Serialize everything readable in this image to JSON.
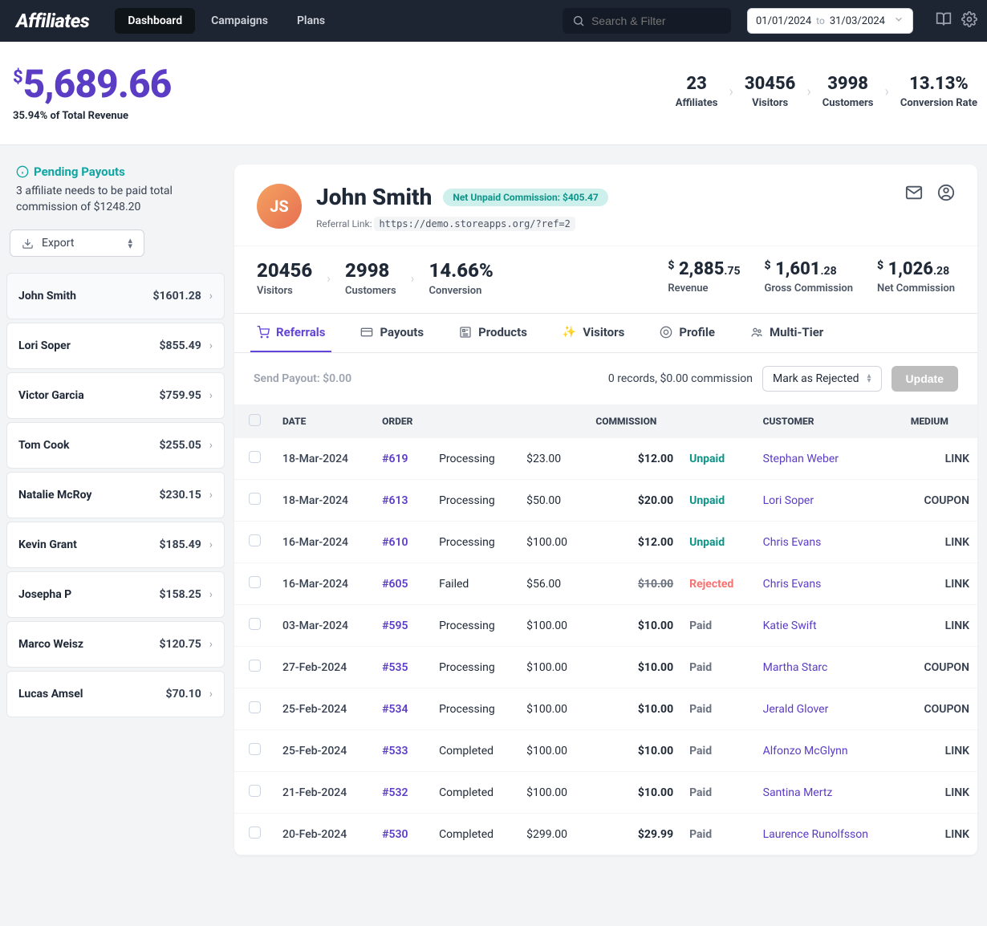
{
  "nav": {
    "brand": "Affiliates",
    "items": [
      "Dashboard",
      "Campaigns",
      "Plans"
    ],
    "active": 0,
    "search_placeholder": "Search & Filter",
    "date_from": "01/01/2024",
    "date_to_label": "to",
    "date_to": "31/03/2024"
  },
  "kpi": {
    "revenue": "5,689.66",
    "revenue_sub": "35.94% of Total Revenue",
    "stats": [
      {
        "v": "23",
        "l": "Affiliates"
      },
      {
        "v": "30456",
        "l": "Visitors"
      },
      {
        "v": "3998",
        "l": "Customers"
      },
      {
        "v": "13.13%",
        "l": "Conversion Rate"
      }
    ]
  },
  "sidebar": {
    "title": "Pending Payouts",
    "desc": "3 affiliate needs to be paid total commission of $1248.20",
    "export": "Export",
    "affiliates": [
      {
        "name": "John Smith",
        "amt": "$1601.28",
        "sel": true
      },
      {
        "name": "Lori Soper",
        "amt": "$855.49"
      },
      {
        "name": "Victor Garcia",
        "amt": "$759.95"
      },
      {
        "name": "Tom Cook",
        "amt": "$255.05"
      },
      {
        "name": "Natalie McRoy",
        "amt": "$230.15"
      },
      {
        "name": "Kevin Grant",
        "amt": "$185.49"
      },
      {
        "name": "Josepha P",
        "amt": "$158.25"
      },
      {
        "name": "Marco Weisz",
        "amt": "$120.75"
      },
      {
        "name": "Lucas Amsel",
        "amt": "$70.10"
      }
    ]
  },
  "detail": {
    "name": "John Smith",
    "avatar_initials": "JS",
    "badge": "Net Unpaid Commission: $405.47",
    "ref_label": "Referral Link:",
    "ref_url": "https://demo.storeapps.org/?ref=2",
    "stats": [
      {
        "v": "20456",
        "l": "Visitors"
      },
      {
        "v": "2998",
        "l": "Customers"
      },
      {
        "v": "14.66%",
        "l": "Conversion"
      }
    ],
    "money": [
      {
        "whole": "2,885",
        "cents": ".75",
        "l": "Revenue"
      },
      {
        "whole": "1,601",
        "cents": ".28",
        "l": "Gross Commission"
      },
      {
        "whole": "1,026",
        "cents": ".28",
        "l": "Net Commission"
      }
    ],
    "tabs": [
      "Referrals",
      "Payouts",
      "Products",
      "Visitors",
      "Profile",
      "Multi-Tier"
    ],
    "active_tab": 0,
    "send_payout": "Send Payout: $0.00",
    "records_info": "0 records, $0.00 commission",
    "mark_label": "Mark as Rejected",
    "update_label": "Update",
    "columns": [
      "DATE",
      "ORDER",
      "",
      "",
      "COMMISSION",
      "",
      "CUSTOMER",
      "MEDIUM"
    ],
    "rows": [
      {
        "date": "18-Mar-2024",
        "order": "#619",
        "ostatus": "Processing",
        "amount": "$23.00",
        "comm": "$12.00",
        "cstatus": "Unpaid",
        "cust": "Stephan Weber",
        "medium": "LINK"
      },
      {
        "date": "18-Mar-2024",
        "order": "#613",
        "ostatus": "Processing",
        "amount": "$50.00",
        "comm": "$20.00",
        "cstatus": "Unpaid",
        "cust": "Lori Soper",
        "medium": "COUPON"
      },
      {
        "date": "16-Mar-2024",
        "order": "#610",
        "ostatus": "Processing",
        "amount": "$100.00",
        "comm": "$12.00",
        "cstatus": "Unpaid",
        "cust": "Chris Evans",
        "medium": "LINK"
      },
      {
        "date": "16-Mar-2024",
        "order": "#605",
        "ostatus": "Failed",
        "amount": "$56.00",
        "comm": "$10.00",
        "cstatus": "Rejected",
        "cust": "Chris Evans",
        "medium": "LINK"
      },
      {
        "date": "03-Mar-2024",
        "order": "#595",
        "ostatus": "Processing",
        "amount": "$100.00",
        "comm": "$10.00",
        "cstatus": "Paid",
        "cust": "Katie Swift",
        "medium": "LINK"
      },
      {
        "date": "27-Feb-2024",
        "order": "#535",
        "ostatus": "Processing",
        "amount": "$100.00",
        "comm": "$10.00",
        "cstatus": "Paid",
        "cust": "Martha Starc",
        "medium": "COUPON"
      },
      {
        "date": "25-Feb-2024",
        "order": "#534",
        "ostatus": "Processing",
        "amount": "$100.00",
        "comm": "$10.00",
        "cstatus": "Paid",
        "cust": "Jerald Glover",
        "medium": "COUPON"
      },
      {
        "date": "25-Feb-2024",
        "order": "#533",
        "ostatus": "Completed",
        "amount": "$100.00",
        "comm": "$10.00",
        "cstatus": "Paid",
        "cust": "Alfonzo McGlynn",
        "medium": "LINK"
      },
      {
        "date": "21-Feb-2024",
        "order": "#532",
        "ostatus": "Completed",
        "amount": "$100.00",
        "comm": "$10.00",
        "cstatus": "Paid",
        "cust": "Santina Mertz",
        "medium": "LINK"
      },
      {
        "date": "20-Feb-2024",
        "order": "#530",
        "ostatus": "Completed",
        "amount": "$299.00",
        "comm": "$29.99",
        "cstatus": "Paid",
        "cust": "Laurence Runolfsson",
        "medium": "LINK"
      }
    ]
  }
}
